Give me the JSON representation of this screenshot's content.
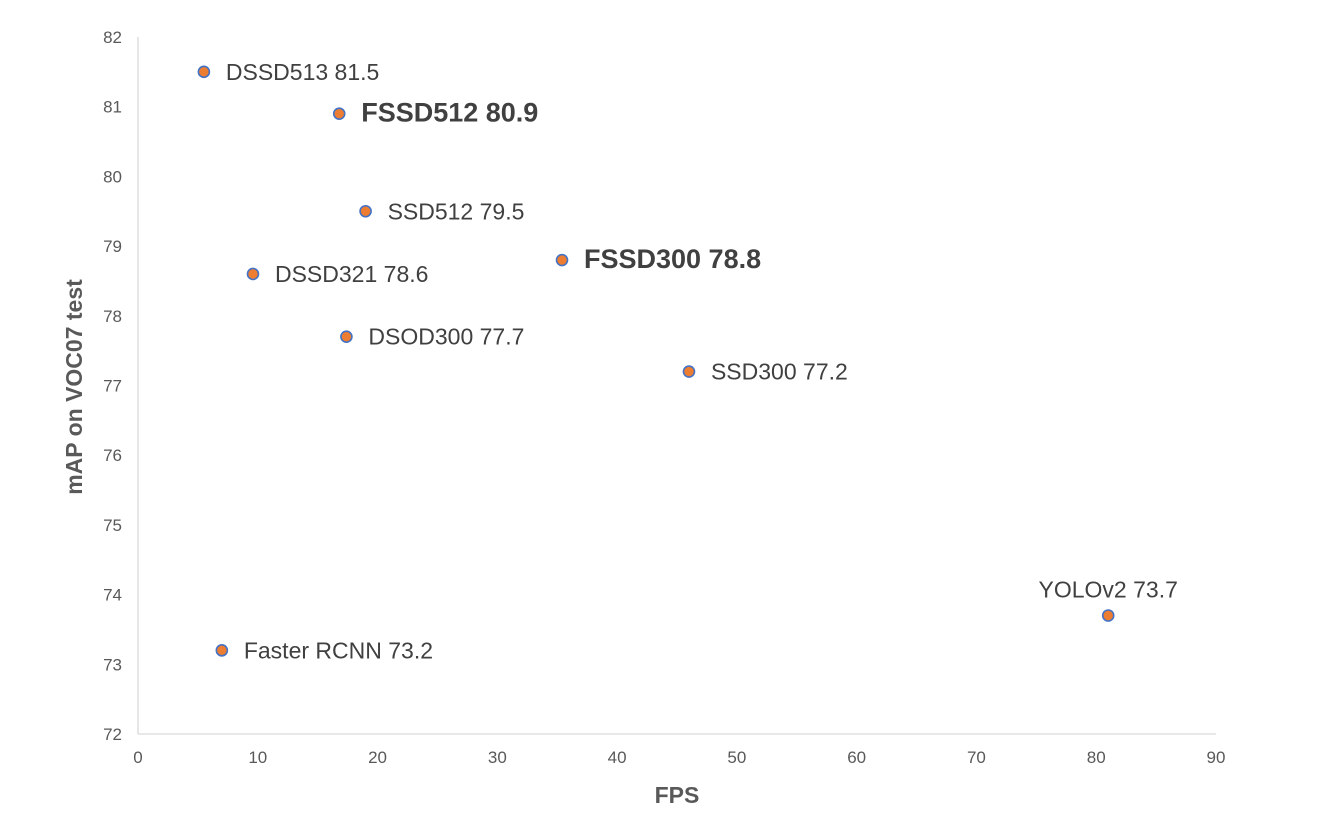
{
  "chart_data": {
    "type": "scatter",
    "title": "",
    "xlabel": "FPS",
    "ylabel": "mAP on VOC07 test",
    "xlim": [
      0,
      90
    ],
    "ylim": [
      72,
      82
    ],
    "x_ticks": [
      "0",
      "10",
      "20",
      "30",
      "40",
      "50",
      "60",
      "70",
      "80",
      "90"
    ],
    "y_ticks": [
      "72",
      "73",
      "74",
      "75",
      "76",
      "77",
      "78",
      "79",
      "80",
      "81",
      "82"
    ],
    "grid": false,
    "legend": "none",
    "marker_fill": "#ED7D31",
    "marker_stroke": "#4472C4",
    "axis_color": "#D9D9D9",
    "points": [
      {
        "x": 5.5,
        "y": 81.5,
        "label": "DSSD513 81.5",
        "bold": false
      },
      {
        "x": 16.8,
        "y": 80.9,
        "label": "FSSD512 80.9",
        "bold": true
      },
      {
        "x": 19.0,
        "y": 79.5,
        "label": "SSD512 79.5",
        "bold": false
      },
      {
        "x": 35.4,
        "y": 78.8,
        "label": "FSSD300 78.8",
        "bold": true
      },
      {
        "x": 9.6,
        "y": 78.6,
        "label": "DSSD321 78.6",
        "bold": false
      },
      {
        "x": 17.4,
        "y": 77.7,
        "label": "DSOD300 77.7",
        "bold": false
      },
      {
        "x": 46.0,
        "y": 77.2,
        "label": "SSD300 77.2",
        "bold": false
      },
      {
        "x": 81.0,
        "y": 73.7,
        "label": "YOLOv2 73.7",
        "bold": false
      },
      {
        "x": 7.0,
        "y": 73.2,
        "label": "Faster RCNN 73.2",
        "bold": false
      }
    ]
  }
}
